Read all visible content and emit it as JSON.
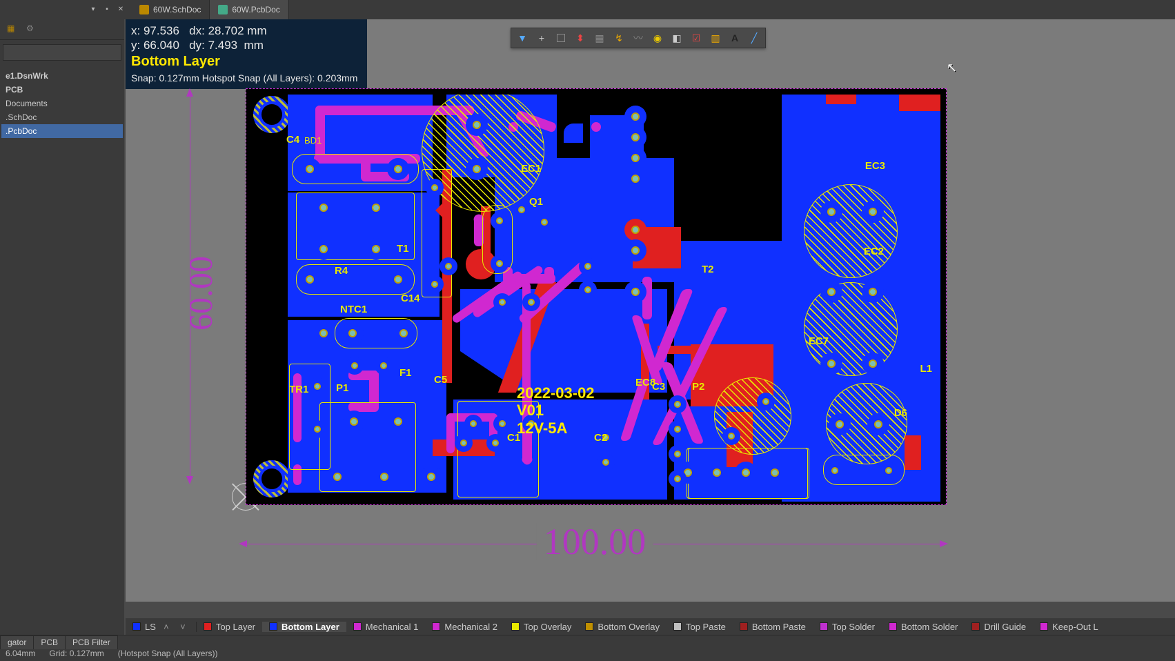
{
  "tabs": {
    "sch": "60W.SchDoc",
    "pcb": "60W.PcbDoc"
  },
  "tree": {
    "items": [
      {
        "label": "e1.DsnWrk",
        "bold": true
      },
      {
        "label": "PCB",
        "bold": true
      },
      {
        "label": "Documents"
      },
      {
        "label": ".SchDoc"
      },
      {
        "label": ".PcbDoc",
        "sel": true
      }
    ]
  },
  "hud": {
    "x_label": "x:",
    "x": "97.536",
    "dx_label": "dx:",
    "dx": "28.702 mm",
    "y_label": "y:",
    "y": "66.040",
    "dy_label": "dy:",
    "dy": "7.493  mm",
    "layer": "Bottom Layer",
    "snap": "Snap: 0.127mm Hotspot Snap (All Layers): 0.203mm"
  },
  "dimensions": {
    "width": "100.00",
    "height": "60.00"
  },
  "overlay": {
    "line1": "2022-03-02",
    "line2": "V01",
    "line3": "12V-5A"
  },
  "designators": {
    "C4": "C4",
    "BD1": "BD1",
    "EC1": "EC1",
    "Q1": "Q1",
    "T1": "T1",
    "NTC1": "NTC1",
    "TR1": "TR1",
    "P1": "P1",
    "F1": "F1",
    "C5": "C5",
    "C14": "C14",
    "C1": "C1",
    "C2": "C2",
    "C3": "C3",
    "P2": "P2",
    "T2": "T2",
    "EC2": "EC2",
    "EC3": "EC3",
    "EC7": "EC7",
    "EC8": "EC8",
    "L1": "L1",
    "D6": "D6",
    "R4": "R4"
  },
  "layerbar": {
    "ls": "LS",
    "items": [
      {
        "color": "#e02020",
        "label": "Top Layer"
      },
      {
        "color": "#1030ff",
        "label": "Bottom Layer",
        "active": true
      },
      {
        "color": "#d028d0",
        "label": "Mechanical 1"
      },
      {
        "color": "#d028d0",
        "label": "Mechanical 2"
      },
      {
        "color": "#e8e800",
        "label": "Top Overlay"
      },
      {
        "color": "#c09000",
        "label": "Bottom Overlay"
      },
      {
        "color": "#c0c0c0",
        "label": "Top Paste"
      },
      {
        "color": "#a02020",
        "label": "Bottom Paste"
      },
      {
        "color": "#c030d0",
        "label": "Top Solder"
      },
      {
        "color": "#d028d0",
        "label": "Bottom Solder"
      },
      {
        "color": "#a02020",
        "label": "Drill Guide"
      },
      {
        "color": "#d028d0",
        "label": "Keep-Out L"
      }
    ]
  },
  "panel_tabs": [
    "gator",
    "PCB",
    "PCB Filter"
  ],
  "status": {
    "coord": "6.04mm",
    "grid": "Grid: 0.127mm",
    "snap": "(Hotspot Snap (All Layers))"
  }
}
